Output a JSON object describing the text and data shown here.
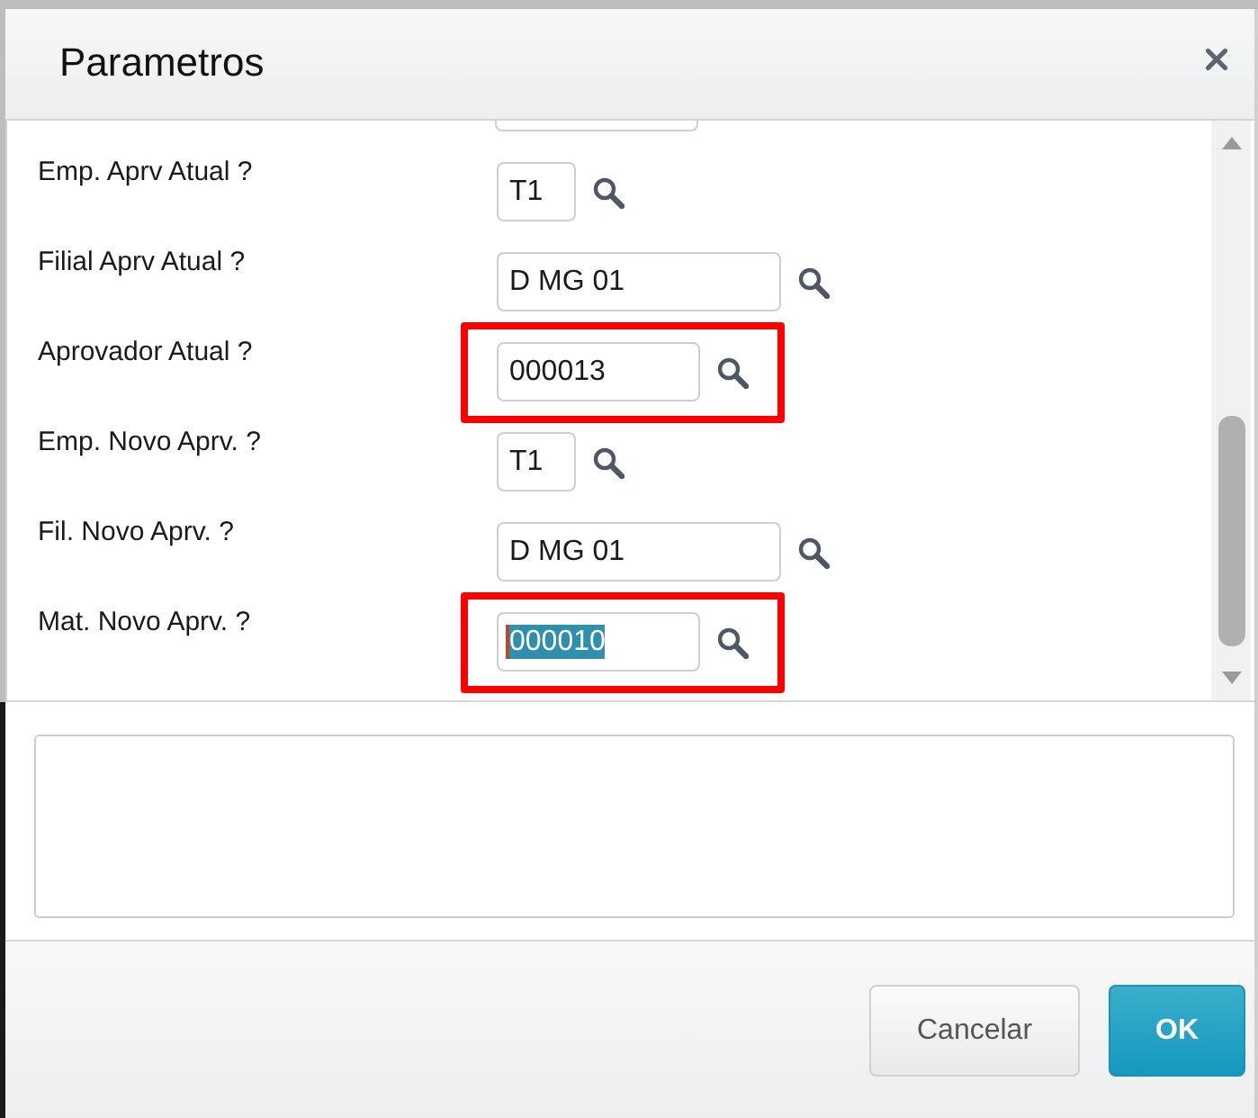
{
  "dialog": {
    "title": "Parametros"
  },
  "params": [
    {
      "kind": "medium",
      "cut_off": true
    },
    {
      "kind": "short",
      "cut_off": false,
      "label": "Emp. Aprv Atual ?",
      "value": "T1",
      "highlighted": false,
      "text_selected": false
    },
    {
      "kind": "long",
      "cut_off": false,
      "label": "Filial Aprv Atual ?",
      "value": "D MG 01",
      "highlighted": false,
      "text_selected": false
    },
    {
      "kind": "medium",
      "cut_off": false,
      "label": "Aprovador Atual ?",
      "value": "000013",
      "highlighted": true,
      "text_selected": false
    },
    {
      "kind": "short",
      "cut_off": false,
      "label": "Emp. Novo Aprv. ?",
      "value": "T1",
      "highlighted": false,
      "text_selected": false
    },
    {
      "kind": "long",
      "cut_off": false,
      "label": "Fil. Novo Aprv. ?",
      "value": "D MG 01",
      "highlighted": false,
      "text_selected": false
    },
    {
      "kind": "medium",
      "cut_off": false,
      "label": "Mat. Novo Aprv. ?",
      "value": "000010",
      "highlighted": true,
      "text_selected": true
    }
  ],
  "buttons": [
    {
      "label": "Cancelar",
      "kind": "secondary"
    },
    {
      "label": "OK",
      "kind": "primary"
    }
  ]
}
